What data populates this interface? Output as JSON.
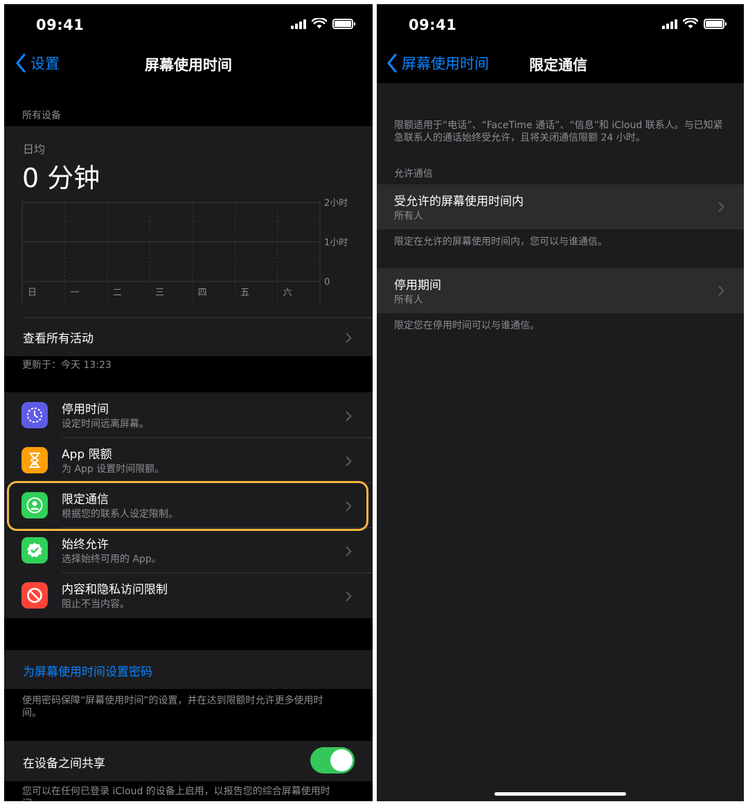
{
  "left": {
    "status": {
      "time": "09:41"
    },
    "nav": {
      "back_label": "设置",
      "title": "屏幕使用时间"
    },
    "all_devices_header": "所有设备",
    "summary": {
      "avg_label": "日均",
      "avg_value": "0 分钟",
      "y_labels": [
        "2小时",
        "1小时",
        "0"
      ],
      "days": [
        "日",
        "一",
        "二",
        "三",
        "四",
        "五",
        "六"
      ],
      "values_minutes": [
        0,
        0,
        0,
        0,
        0,
        0,
        0
      ]
    },
    "view_all_label": "查看所有活动",
    "updated_text": "更新于：今天 13:23",
    "items": [
      {
        "title": "停用时间",
        "subtitle": "设定时间远离屏幕。",
        "icon": "downtime-icon",
        "color": "#5e5ce6"
      },
      {
        "title": "App 限额",
        "subtitle": "为 App 设置时间限额。",
        "icon": "hourglass-icon",
        "color": "#ff9f0a"
      },
      {
        "title": "限定通信",
        "subtitle": "根据您的联系人设定限制。",
        "icon": "contact-icon",
        "color": "#30d158"
      },
      {
        "title": "始终允许",
        "subtitle": "选择始终可用的 App。",
        "icon": "checkmark-badge-icon",
        "color": "#30d158"
      },
      {
        "title": "内容和隐私访问限制",
        "subtitle": "阻止不当内容。",
        "icon": "restriction-icon",
        "color": "#ff453a"
      }
    ],
    "passcode_label": "为屏幕使用时间设置密码",
    "passcode_footer": "使用密码保障“屏幕使用时间”的设置，并在达到限额时允许更多使用时间。",
    "share_label": "在设备之间共享",
    "share_on": true,
    "share_footer": "您可以在任何已登录 iCloud 的设备上启用，以报告您的综合屏幕使用时间。"
  },
  "right": {
    "status": {
      "time": "09:41"
    },
    "nav": {
      "back_label": "屏幕使用时间",
      "title": "限定通信"
    },
    "intro": "限额适用于“电话”、“FaceTime 通话”、“信息”和 iCloud 联系人。与已知紧急联系人的通话始终受允许，且将关闭通信限额 24 小时。",
    "allowed_header": "允许通信",
    "during_screen_time": {
      "title": "受允许的屏幕使用时间内",
      "value": "所有人"
    },
    "during_screen_time_footer": "限定在允许的屏幕使用时间内，您可以与谁通信。",
    "during_downtime": {
      "title": "停用期间",
      "value": "所有人"
    },
    "during_downtime_footer": "限定您在停用时间可以与谁通信。"
  },
  "colors": {
    "accent": "#0a84ff",
    "highlight": "#f5b640",
    "toggle_on": "#34c759",
    "group_bg": "#1c1c1e"
  }
}
